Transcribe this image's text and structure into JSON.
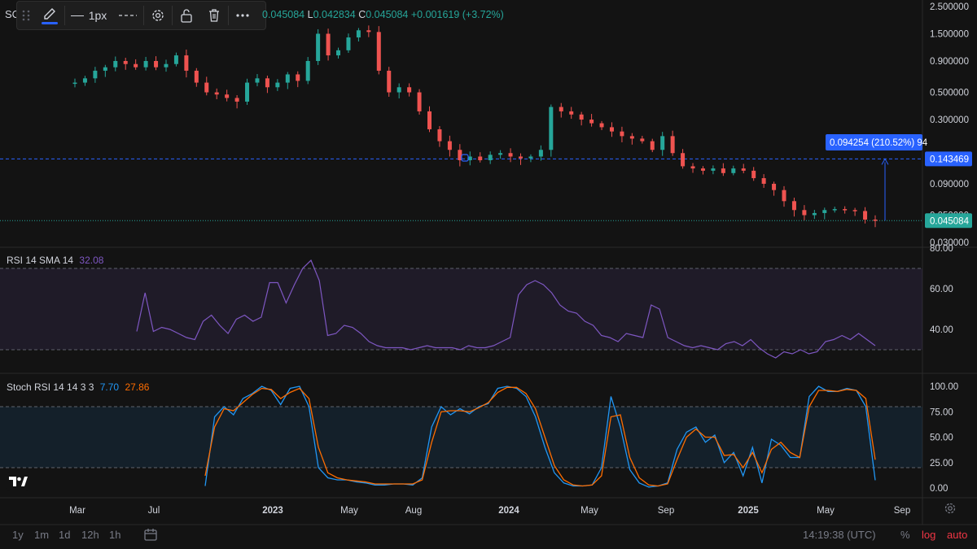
{
  "symbol": "SC",
  "toolbar": {
    "line_width_label": "1px"
  },
  "ohlc": {
    "h_value": "0.045084",
    "l_key": "L",
    "l_value": "0.042834",
    "c_key": "C",
    "c_value": "0.045084",
    "change": "+0.001619 (+3.72%)"
  },
  "price_axis": {
    "ticks": [
      "2.500000",
      "1.500000",
      "0.900000",
      "0.500000",
      "0.300000",
      "0.090000",
      "0.050000",
      "0.030000"
    ],
    "last_price": "0.045084",
    "level_price": "0.143469",
    "measure_label": "0.094254 (210.52%) 94"
  },
  "rsi": {
    "label": "RSI 14 SMA 14",
    "value": "32.08",
    "ticks": [
      "80.00",
      "60.00",
      "40.00"
    ]
  },
  "stoch": {
    "label": "Stoch RSI 14 14 3 3",
    "k_value": "7.70",
    "d_value": "27.86",
    "ticks": [
      "100.00",
      "75.00",
      "50.00",
      "25.00",
      "0.00"
    ]
  },
  "time_axis": [
    "Mar",
    "Jul",
    "2023",
    "May",
    "Aug",
    "2024",
    "May",
    "Sep",
    "2025",
    "May",
    "Sep"
  ],
  "timeframes": [
    "1y",
    "1m",
    "1d",
    "12h",
    "1h"
  ],
  "clock": "14:19:38 (UTC)",
  "scale_buttons": {
    "percent": "%",
    "log": "log",
    "auto": "auto"
  },
  "colors": {
    "up": "#26a69a",
    "down": "#ef5350",
    "rsi": "#7e57c2",
    "stoch_k": "#2196f3",
    "stoch_d": "#ff6d00",
    "accent": "#2962ff"
  },
  "chart_data": [
    {
      "type": "candlestick",
      "scale": "log",
      "ylim": [
        0.03,
        2.5
      ],
      "y_ticks": [
        2.5,
        1.5,
        0.9,
        0.5,
        0.3,
        0.09,
        0.05,
        0.03
      ],
      "x_tick_labels": [
        "Mar",
        "Jul",
        "2023",
        "May",
        "Aug",
        "2024",
        "May",
        "Sep",
        "2025",
        "May",
        "Sep"
      ],
      "close_path": [
        0.6,
        0.65,
        0.75,
        0.8,
        0.9,
        0.85,
        0.8,
        0.9,
        0.8,
        0.85,
        1.0,
        0.75,
        0.6,
        0.5,
        0.48,
        0.45,
        0.42,
        0.6,
        0.65,
        0.55,
        0.6,
        0.7,
        0.62,
        0.9,
        1.5,
        1.0,
        1.1,
        1.4,
        1.6,
        1.55,
        0.75,
        0.5,
        0.55,
        0.5,
        0.35,
        0.25,
        0.2,
        0.17,
        0.14,
        0.15,
        0.14,
        0.155,
        0.16,
        0.15,
        0.145,
        0.15,
        0.17,
        0.38,
        0.35,
        0.33,
        0.3,
        0.28,
        0.26,
        0.24,
        0.22,
        0.21,
        0.2,
        0.17,
        0.22,
        0.16,
        0.125,
        0.12,
        0.115,
        0.12,
        0.11,
        0.12,
        0.115,
        0.1,
        0.09,
        0.08,
        0.065,
        0.055,
        0.05,
        0.052,
        0.055,
        0.056,
        0.055,
        0.054,
        0.046,
        0.045
      ],
      "last_price": 0.045084,
      "horizontal_level": 0.143469,
      "measure": {
        "from": 0.045084,
        "to": 0.143469,
        "label": "0.094254 (210.52%) 94"
      }
    },
    {
      "type": "line",
      "name": "RSI 14 SMA 14",
      "ylim": [
        20,
        80
      ],
      "bands": [
        30,
        70
      ],
      "series": [
        {
          "name": "RSI 14 SMA 14",
          "values": [
            39,
            58,
            39,
            41,
            40,
            38,
            36,
            35,
            44,
            47,
            42,
            38,
            45,
            47,
            44,
            46,
            63,
            63,
            53,
            62,
            70,
            74,
            64,
            37,
            38,
            42,
            41,
            38,
            34,
            32,
            31,
            31,
            31,
            30,
            31,
            32,
            31,
            31,
            31,
            30,
            32,
            31,
            31,
            32,
            34,
            36,
            57,
            62,
            64,
            62,
            58,
            52,
            49,
            48,
            44,
            42,
            37,
            36,
            34,
            38,
            37,
            36,
            52,
            50,
            36,
            34,
            32,
            31,
            32,
            31,
            30,
            33,
            34,
            32,
            35,
            31,
            28,
            26,
            29,
            28,
            30,
            28,
            29,
            34,
            35,
            37,
            35,
            38,
            35,
            32
          ]
        }
      ],
      "last_value": 32.08
    },
    {
      "type": "line",
      "name": "Stoch RSI 14 14 3 3",
      "ylim": [
        0,
        100
      ],
      "bands": [
        20,
        80
      ],
      "series": [
        {
          "name": "K",
          "values": [
            2,
            70,
            80,
            72,
            88,
            93,
            100,
            96,
            82,
            98,
            100,
            80,
            20,
            10,
            8,
            8,
            6,
            5,
            3,
            3,
            4,
            4,
            3,
            10,
            60,
            80,
            72,
            78,
            73,
            80,
            83,
            98,
            100,
            98,
            90,
            70,
            40,
            15,
            5,
            2,
            2,
            3,
            20,
            90,
            60,
            18,
            5,
            1,
            2,
            5,
            38,
            55,
            60,
            45,
            52,
            25,
            35,
            12,
            40,
            5,
            48,
            42,
            30,
            30,
            90,
            100,
            95,
            95,
            98,
            96,
            80,
            7.7
          ]
        },
        {
          "name": "D",
          "values": [
            12,
            60,
            78,
            76,
            84,
            92,
            98,
            97,
            88,
            94,
            98,
            88,
            40,
            15,
            10,
            8,
            7,
            6,
            4,
            4,
            4,
            4,
            4,
            8,
            45,
            75,
            76,
            76,
            75,
            79,
            84,
            94,
            99,
            99,
            93,
            78,
            50,
            22,
            8,
            3,
            2,
            3,
            12,
            70,
            72,
            30,
            10,
            3,
            2,
            4,
            28,
            50,
            58,
            50,
            50,
            32,
            33,
            20,
            35,
            15,
            38,
            45,
            35,
            30,
            80,
            96,
            96,
            95,
            97,
            96,
            88,
            27.86
          ]
        }
      ]
    }
  ]
}
